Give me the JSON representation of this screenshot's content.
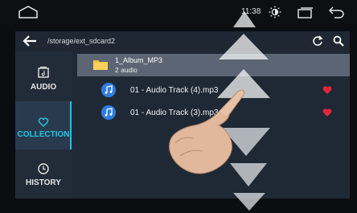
{
  "status_bar": {
    "time": "11:38",
    "icons": [
      "home-icon",
      "brightness-icon",
      "window-icon",
      "back-icon"
    ]
  },
  "path_bar": {
    "path": "/storage/ext_sdcard2",
    "icons": [
      "back-arrow-icon",
      "refresh-icon",
      "search-icon"
    ]
  },
  "sidebar": {
    "items": [
      {
        "label": "AUDIO",
        "icon": "audio-folder-icon",
        "active": false
      },
      {
        "label": "COLLECTION",
        "icon": "heart-outline-icon",
        "active": true
      },
      {
        "label": "HISTORY",
        "icon": "clock-icon",
        "active": false
      }
    ]
  },
  "list": {
    "folder": {
      "name": "1_Album_MP3",
      "count": "2 audio"
    },
    "tracks": [
      {
        "name": "01 - Audio Track (4).mp3",
        "favorite": true
      },
      {
        "name": "01 - Audio Track (3).mp3",
        "favorite": true
      }
    ]
  },
  "colors": {
    "accent": "#22c8e6",
    "favorite": "#e0283a",
    "music_icon": "#2f7de1",
    "folder": "#f6c342"
  }
}
